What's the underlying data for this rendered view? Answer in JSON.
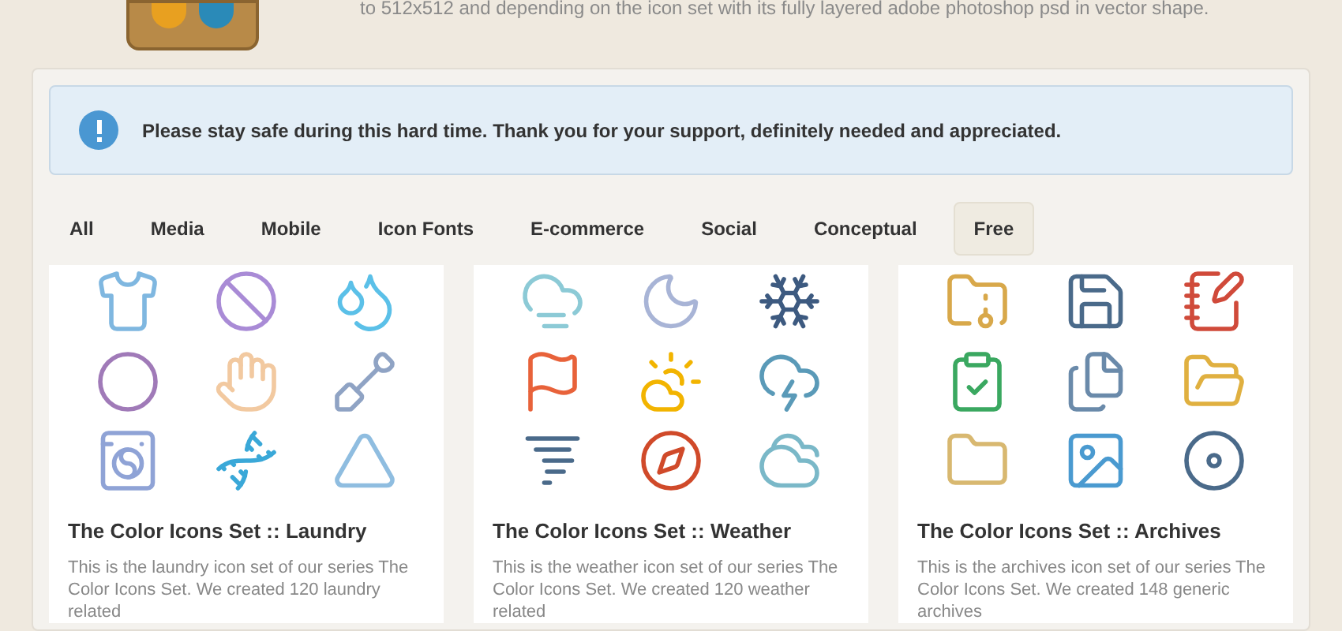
{
  "header": {
    "intro": "to 512x512 and depending on the icon set with its fully layered adobe photoshop psd in vector shape."
  },
  "notice": {
    "text": "Please stay safe during this hard time. Thank you for your support, definitely needed and appreciated."
  },
  "tabs": [
    {
      "label": "All",
      "selected": false
    },
    {
      "label": "Media",
      "selected": false
    },
    {
      "label": "Mobile",
      "selected": false
    },
    {
      "label": "Icon Fonts",
      "selected": false
    },
    {
      "label": "E-commerce",
      "selected": false
    },
    {
      "label": "Social",
      "selected": false
    },
    {
      "label": "Conceptual",
      "selected": false
    },
    {
      "label": "Free",
      "selected": true
    }
  ],
  "cards": [
    {
      "kind": "laundry",
      "title": "The Color Icons Set :: Laundry",
      "description": "This is the laundry icon set of our series The Color Icons Set. We created 120 laundry related"
    },
    {
      "kind": "weather",
      "title": "The Color Icons Set :: Weather",
      "description": "This is the weather icon set of our series The Color Icons Set. We created 120 weather related"
    },
    {
      "kind": "archives",
      "title": "The Color Icons Set :: Archives",
      "description": "This is the archives icon set of our series The Color Icons Set. We created 148 generic archives"
    }
  ]
}
